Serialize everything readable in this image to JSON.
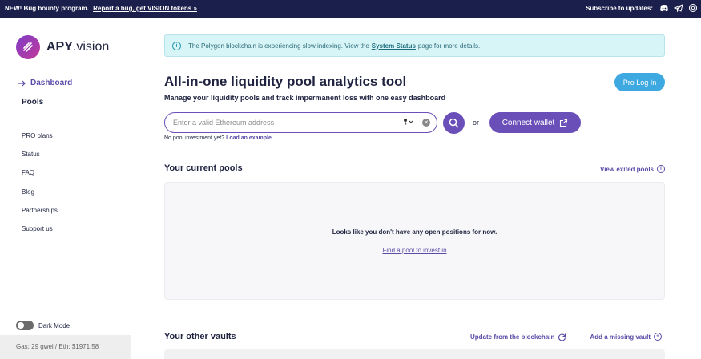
{
  "topbar": {
    "announcement": "NEW! Bug bounty program.",
    "announcement_link": "Report a bug, get VISION tokens »",
    "subscribe": "Subscribe to updates:",
    "icons": [
      "discord-icon",
      "telegram-icon",
      "email-icon"
    ]
  },
  "sidebar": {
    "logo_bold": "APY",
    "logo_rest": ".vision",
    "dashboard": "Dashboard",
    "pools": "Pools",
    "items": [
      "PRO plans",
      "Status",
      "FAQ",
      "Blog",
      "Partnerships",
      "Support us"
    ],
    "dark_mode": "Dark Mode",
    "gas": "Gas: 29 gwei / Eth: $1971.58"
  },
  "alert": {
    "text_before": "The Polygon blockchain is experiencing slow indexing. View the",
    "link": "System Status",
    "text_after": "page for more details."
  },
  "main": {
    "title": "All-in-one liquidity pool analytics tool",
    "subtitle": "Manage your liquidity pools and track impermanent loss with one easy dashboard",
    "pro_login": "Pro Log In",
    "search_placeholder": "Enter a valid Ethereum address",
    "or": "or",
    "connect_wallet": "Connect wallet",
    "no_pool_text": "No pool investment yet?",
    "load_example": "Load an example"
  },
  "current_pools": {
    "title": "Your current pools",
    "view_exited": "View exited pools",
    "empty_message": "Looks like you don't have any open positions for now.",
    "find_pool": "Find a pool to invest in"
  },
  "other_vaults": {
    "title": "Your other vaults",
    "update": "Update from the blockchain",
    "add_missing": "Add a missing vault"
  },
  "colors": {
    "accent": "#6a4fb8",
    "topbar": "#1b1f4b",
    "pro_button": "#3ea9e1",
    "alert_bg": "#d7f4f7"
  }
}
